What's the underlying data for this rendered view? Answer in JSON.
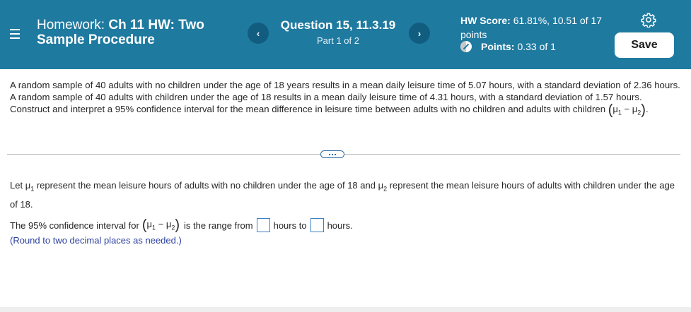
{
  "header": {
    "title_prefix": "Homework: ",
    "title_name": "Ch 11 HW: Two Sample Procedure",
    "question_title": "Question 15, 11.3.19",
    "part_label": "Part 1 of 2",
    "prev_glyph": "‹",
    "next_glyph": "›",
    "hw_score_label": "HW Score:",
    "hw_score_value": "61.81%, 10.51 of 17 points",
    "points_label": "Points:",
    "points_value": "0.33 of 1",
    "save_label": "Save",
    "colors": {
      "bar": "#1f7aa0",
      "nav_button": "#115d80"
    }
  },
  "problem": {
    "text": "A random sample of 40 adults with no children under the age of 18 years results in a mean daily leisure time of 5.07 hours, with a standard deviation of 2.36 hours. A random sample of 40 adults with children under the age of 18 results in a mean daily leisure time of 4.31 hours, with a standard deviation of 1.57 hours. Construct and interpret a 95% confidence interval for the mean difference in leisure time between adults with no children and adults with children",
    "mu": "μ",
    "sub1": "1",
    "sub2": "2",
    "minus": "−",
    "end": "."
  },
  "definition": {
    "part1": "Let ",
    "part2": " represent the mean leisure hours of adults with no children under the age of 18 and ",
    "part3": " represent the mean leisure hours of adults with children under the age of 18."
  },
  "ci": {
    "lead": "The 95% confidence interval for ",
    "range_from": "is the range from",
    "hours_to": "hours to",
    "hours_end": "hours.",
    "lower_value": "",
    "upper_value": "",
    "round_note": "(Round to two decimal places as needed.)"
  }
}
